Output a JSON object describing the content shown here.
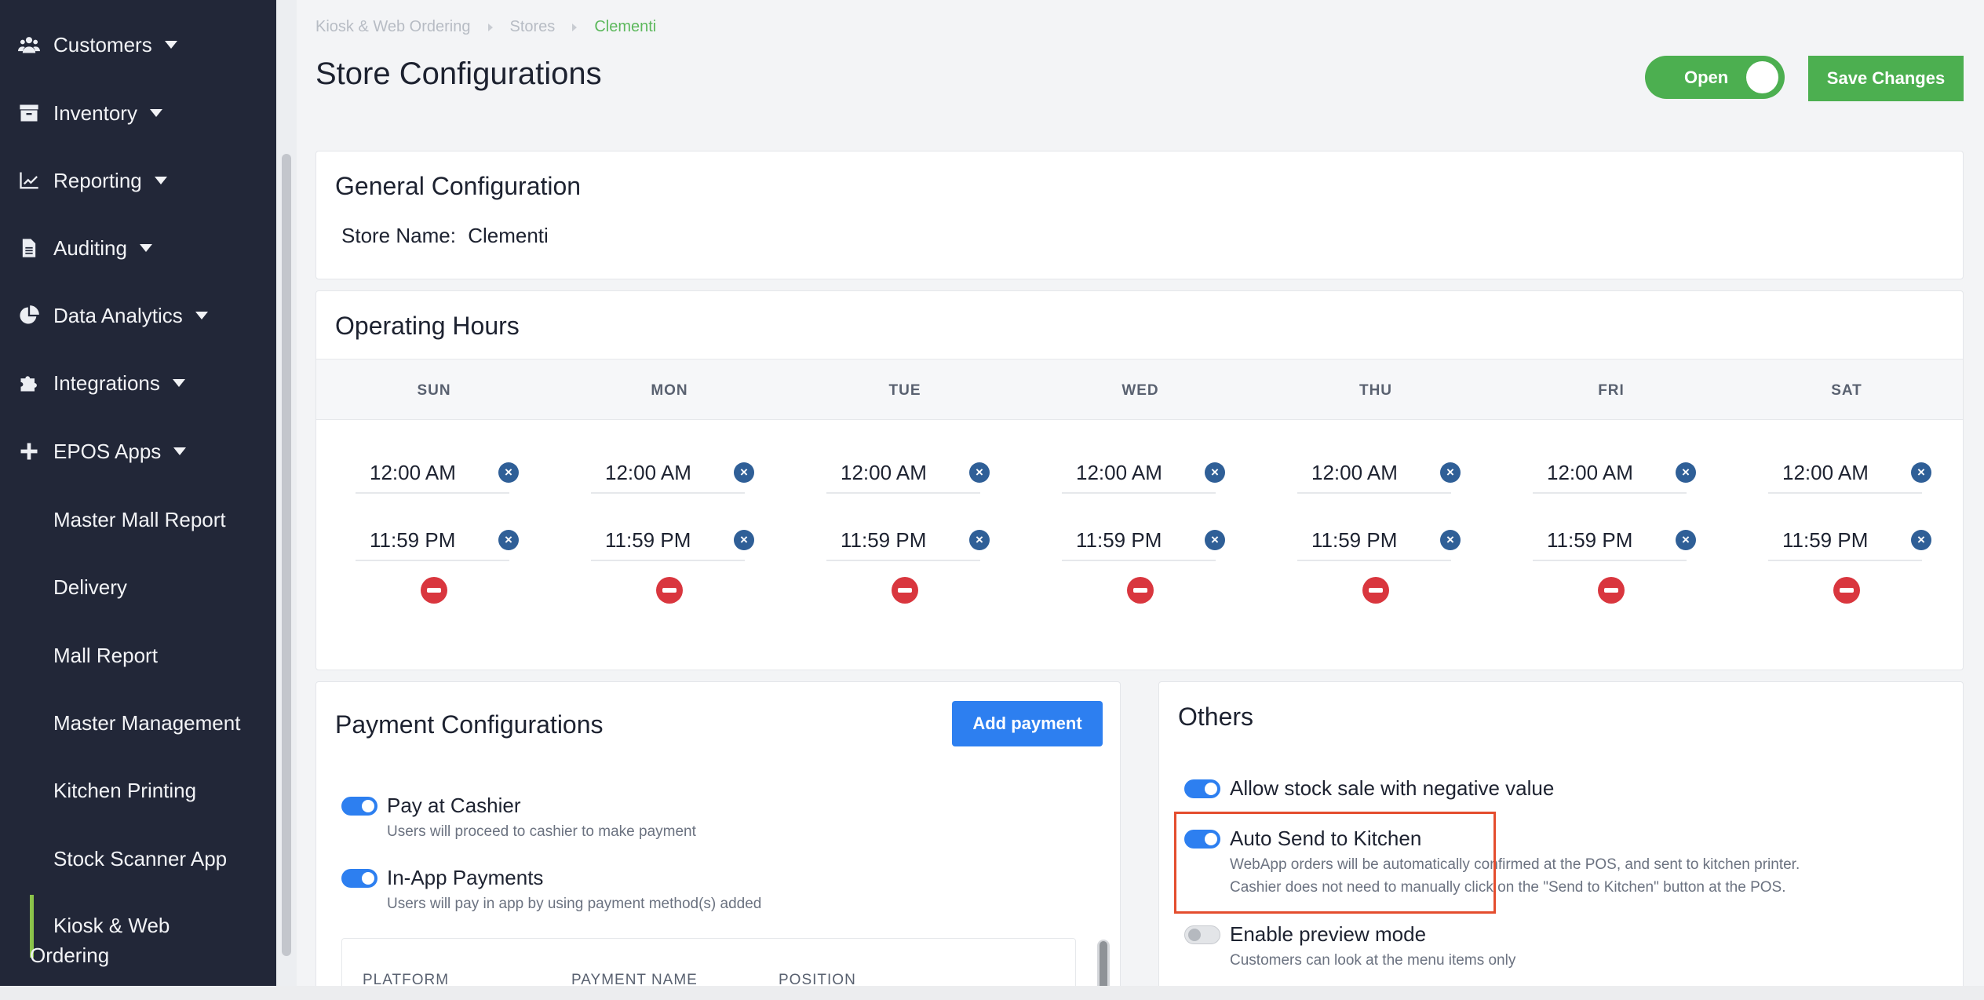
{
  "sidebar": {
    "items": [
      {
        "label": "Customers",
        "icon": "users-icon"
      },
      {
        "label": "Inventory",
        "icon": "archive-icon"
      },
      {
        "label": "Reporting",
        "icon": "line-chart-icon"
      },
      {
        "label": "Auditing",
        "icon": "document-icon"
      },
      {
        "label": "Data Analytics",
        "icon": "pie-chart-icon"
      },
      {
        "label": "Integrations",
        "icon": "puzzle-icon"
      },
      {
        "label": "EPOS Apps",
        "icon": "plus-icon"
      }
    ],
    "sub_items": [
      {
        "label": "Master Mall Report"
      },
      {
        "label": "Delivery"
      },
      {
        "label": "Mall Report"
      },
      {
        "label": "Master Management"
      },
      {
        "label": "Kitchen Printing"
      },
      {
        "label": "Stock Scanner App"
      }
    ],
    "active_sub": {
      "line1": "Kiosk & Web",
      "line2": "Ordering"
    }
  },
  "breadcrumb": {
    "items": [
      "Kiosk & Web Ordering",
      "Stores",
      "Clementi"
    ]
  },
  "header": {
    "title": "Store Configurations",
    "open_label": "Open",
    "open_state": true,
    "save_label": "Save Changes"
  },
  "general": {
    "title": "General Configuration",
    "store_name_label": "Store Name:",
    "store_name_value": "Clementi"
  },
  "hours": {
    "title": "Operating Hours",
    "days": [
      {
        "day": "SUN",
        "open": "12:00 AM",
        "close": "11:59 PM"
      },
      {
        "day": "MON",
        "open": "12:00 AM",
        "close": "11:59 PM"
      },
      {
        "day": "TUE",
        "open": "12:00 AM",
        "close": "11:59 PM"
      },
      {
        "day": "WED",
        "open": "12:00 AM",
        "close": "11:59 PM"
      },
      {
        "day": "THU",
        "open": "12:00 AM",
        "close": "11:59 PM"
      },
      {
        "day": "FRI",
        "open": "12:00 AM",
        "close": "11:59 PM"
      },
      {
        "day": "SAT",
        "open": "12:00 AM",
        "close": "11:59 PM"
      }
    ]
  },
  "payment": {
    "title": "Payment Configurations",
    "add_label": "Add payment",
    "options": [
      {
        "title": "Pay at Cashier",
        "desc": "Users will proceed to cashier to make payment",
        "enabled": true
      },
      {
        "title": "In-App Payments",
        "desc": "Users will pay in app by using payment method(s) added",
        "enabled": true
      }
    ],
    "table_headers": [
      "PLATFORM",
      "PAYMENT NAME",
      "POSITION"
    ]
  },
  "others": {
    "title": "Others",
    "options": [
      {
        "title": "Allow stock sale with negative value",
        "enabled": true
      },
      {
        "title": "Auto Send to Kitchen",
        "desc1": "WebApp orders will be automatically confirmed at the POS, and sent to kitchen printer.",
        "desc2": "Cashier does not need to manually click on the \"Send to Kitchen\" button at the POS.",
        "enabled": true
      },
      {
        "title": "Enable preview mode",
        "desc": "Customers can look at the menu items only",
        "enabled": false
      }
    ]
  },
  "colors": {
    "sidebar_bg": "#222738",
    "accent_green": "#4caf50",
    "primary_blue": "#2d7ff0",
    "danger_red": "#d9363e",
    "highlight": "#e44d2e"
  }
}
